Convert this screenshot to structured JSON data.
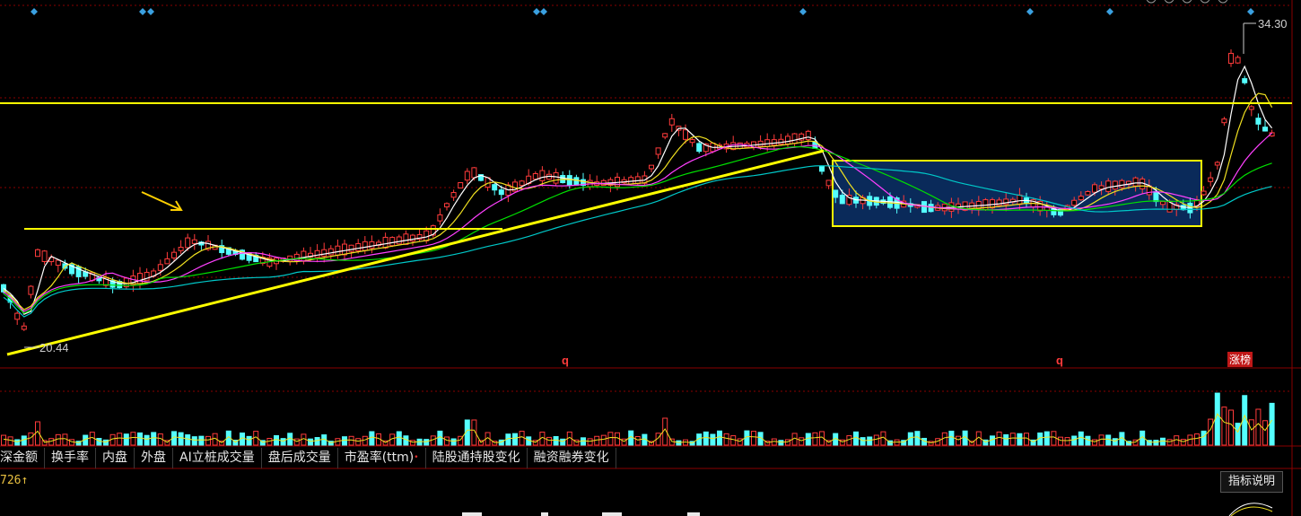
{
  "price": {
    "high_label": "34.30",
    "low_label": "20.44",
    "q_markers": [
      "q",
      "q"
    ],
    "limit_up_badge": "涨榜"
  },
  "tabs": [
    {
      "label": "深金额"
    },
    {
      "label": "换手率"
    },
    {
      "label": "内盘"
    },
    {
      "label": "外盘"
    },
    {
      "label": "AI立桩成交量"
    },
    {
      "label": "盘后成交量"
    },
    {
      "label": "市盈率(ttm)",
      "sup": "•"
    },
    {
      "label": "陆股通持股变化"
    },
    {
      "label": "融资融券变化"
    }
  ],
  "bottom": {
    "readout": "726↑",
    "help_label": "指标说明"
  },
  "colors": {
    "up": "#ff3b3b",
    "down": "#54ffff",
    "ma5": "#ffffff",
    "ma10": "#f0e020",
    "ma20": "#ff40ff",
    "ma30": "#00e000",
    "ma60": "#00c8c8",
    "annotation": "#ffff00",
    "grid": "#8a0000",
    "consolidation_fill": "#0a2a5a"
  }
}
